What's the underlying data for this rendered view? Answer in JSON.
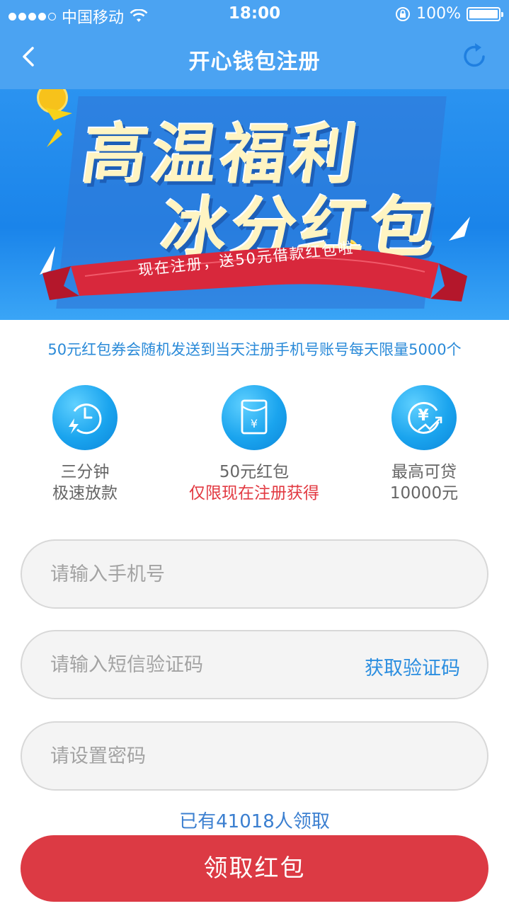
{
  "status_bar": {
    "carrier": "中国移动",
    "time": "18:00",
    "battery": "100%",
    "signal_dots_filled": 4,
    "signal_dots_total": 5
  },
  "nav": {
    "title": "开心钱包注册",
    "back_icon": "chevron-left-icon",
    "refresh_icon": "refresh-icon"
  },
  "banner": {
    "headline_line1": "高温福利",
    "headline_line2": "冰分红包",
    "ribbon_text": "现在注册，送50元借款红包啦"
  },
  "notice": "50元红包券会随机发送到当天注册手机号账号每天限量5000个",
  "features": [
    {
      "icon": "clock-lightning-icon",
      "line1": "三分钟",
      "line2": "极速放款"
    },
    {
      "icon": "red-envelope-icon",
      "line1": "50元红包",
      "line2": "仅限现在注册获得"
    },
    {
      "icon": "yen-chart-icon",
      "line1": "最高可贷",
      "line2": "10000元"
    }
  ],
  "form": {
    "phone_placeholder": "请输入手机号",
    "sms_placeholder": "请输入短信验证码",
    "get_code_label": "获取验证码",
    "password_placeholder": "请设置密码"
  },
  "claimed_count_text": "已有41018人领取",
  "submit_label": "领取红包",
  "colors": {
    "nav_bg": "#4ba3f2",
    "accent_blue": "#2b8ee0",
    "submit_red": "#dc3a44",
    "highlight_red": "#e23a42"
  }
}
